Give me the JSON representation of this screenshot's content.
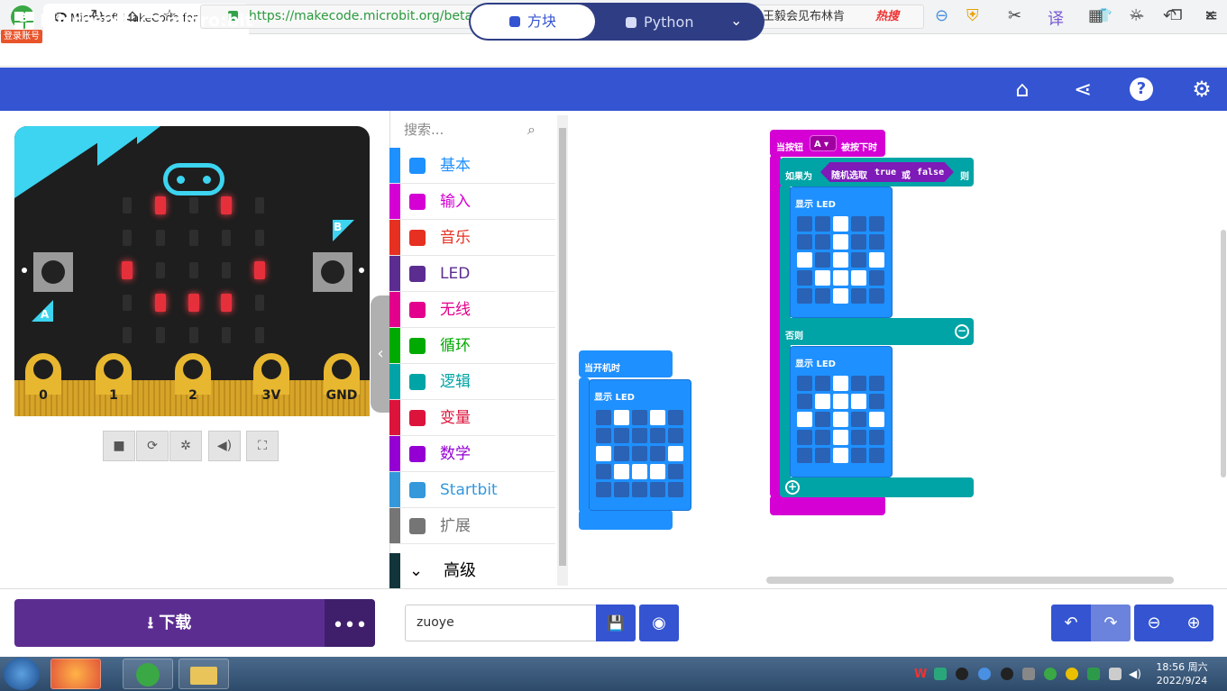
{
  "browser": {
    "brand_glyph": "e",
    "login_badge": "登录账号",
    "tab_title": "Microsoft MakeCode for r",
    "tab_close": "✕",
    "new_tab": "+",
    "url": "https://makecode.microbit.org/beta#editor",
    "search_text": "王毅会见布林肯",
    "search_hot": "热搜"
  },
  "app": {
    "ms_brand": "Microsoft",
    "mb_brand": "micro:bit",
    "blocks_label": "方块",
    "python_label": "Python"
  },
  "simulator": {
    "button_a": "A",
    "button_b": "B",
    "pins": [
      "0",
      "1",
      "2",
      "3V",
      "GND"
    ],
    "leds": [
      [
        0,
        1,
        0,
        1,
        0
      ],
      [
        0,
        0,
        0,
        0,
        0
      ],
      [
        1,
        0,
        0,
        0,
        1
      ],
      [
        0,
        1,
        1,
        1,
        0
      ],
      [
        0,
        0,
        0,
        0,
        0
      ]
    ]
  },
  "toolbox": {
    "search_placeholder": "搜索...",
    "categories": [
      {
        "label": "基本",
        "color": "#1e90ff"
      },
      {
        "label": "输入",
        "color": "#d400d4"
      },
      {
        "label": "音乐",
        "color": "#e63022"
      },
      {
        "label": "LED",
        "color": "#5c2d91"
      },
      {
        "label": "无线",
        "color": "#e3008c"
      },
      {
        "label": "循环",
        "color": "#00aa00"
      },
      {
        "label": "逻辑",
        "color": "#00a4a6"
      },
      {
        "label": "变量",
        "color": "#dc143c"
      },
      {
        "label": "数学",
        "color": "#9400d3"
      },
      {
        "label": "Startbit",
        "color": "#3498db"
      },
      {
        "label": "扩展",
        "color": "#757575"
      }
    ],
    "advanced": "高级"
  },
  "workspace": {
    "on_start": {
      "label": "当开机时",
      "show_led": "显示 LED",
      "leds": [
        [
          0,
          1,
          0,
          1,
          0
        ],
        [
          0,
          0,
          0,
          0,
          0
        ],
        [
          1,
          0,
          0,
          0,
          1
        ],
        [
          0,
          1,
          1,
          1,
          0
        ],
        [
          0,
          0,
          0,
          0,
          0
        ]
      ]
    },
    "on_button": {
      "label_pre": "当按钮",
      "button": "A",
      "label_post": "被按下时",
      "if_label": "如果为",
      "random_label": "随机选取",
      "true_val": "true",
      "or_label": "或",
      "false_val": "false",
      "then_label": "则",
      "else_label": "否则",
      "show_led": "显示 LED",
      "leds_then": [
        [
          0,
          0,
          1,
          0,
          0
        ],
        [
          0,
          0,
          1,
          0,
          0
        ],
        [
          1,
          0,
          1,
          0,
          1
        ],
        [
          0,
          1,
          1,
          1,
          0
        ],
        [
          0,
          0,
          1,
          0,
          0
        ]
      ],
      "leds_else": [
        [
          0,
          0,
          1,
          0,
          0
        ],
        [
          0,
          1,
          1,
          1,
          0
        ],
        [
          1,
          0,
          1,
          0,
          1
        ],
        [
          0,
          0,
          1,
          0,
          0
        ],
        [
          0,
          0,
          1,
          0,
          0
        ]
      ]
    }
  },
  "footer": {
    "download_label": "下载",
    "more_label": "•••",
    "project_name": "zuoye"
  },
  "taskbar": {
    "time": "18:56 周六",
    "date": "2022/9/24"
  },
  "colors": {
    "header": "#3454d1",
    "event_block": "#d400d4",
    "logic_block": "#00a4a6",
    "led_block": "#1e90ff",
    "download": "#5c2d91"
  }
}
